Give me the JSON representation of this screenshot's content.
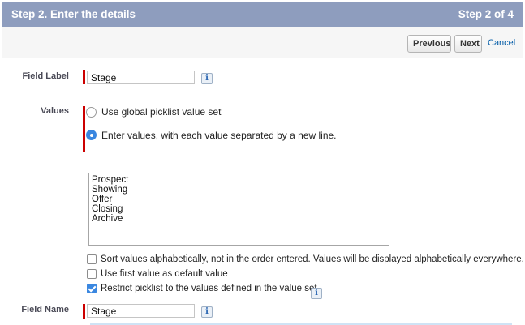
{
  "header": {
    "title": "Step 2. Enter the details",
    "step": "Step 2 of 4"
  },
  "toolbar": {
    "previous_label": "Previous",
    "next_label": "Next",
    "cancel_label": "Cancel"
  },
  "field_label": {
    "label": "Field Label",
    "value": "Stage",
    "info_icon": "i"
  },
  "values": {
    "label": "Values",
    "options": [
      {
        "label": "Use global picklist value set",
        "selected": false
      },
      {
        "label": "Enter values, with each value separated by a new line.",
        "selected": true
      }
    ],
    "entries": [
      "Prospect",
      "Showing",
      "Offer",
      "Closing",
      "Archive"
    ]
  },
  "checkboxes": [
    {
      "label": "Sort values alphabetically, not in the order entered. Values will be displayed alphabetically everywhere.",
      "checked": false
    },
    {
      "label": "Use first value as default value",
      "checked": false
    },
    {
      "label": "Restrict picklist to the values defined in the value set.",
      "checked": true
    }
  ],
  "field_name": {
    "label": "Field Name",
    "value": "Stage",
    "info_icon": "i"
  },
  "colors": {
    "header_bg": "#8e9dbe",
    "required": "#cc0000",
    "accent": "#3a87e0",
    "link": "#015ba7"
  }
}
